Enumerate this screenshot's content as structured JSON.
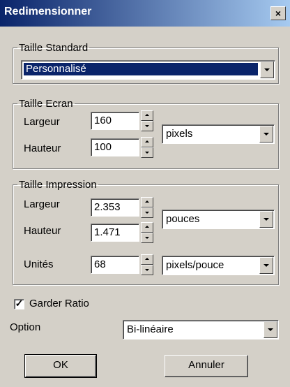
{
  "window": {
    "title": "Redimensionner",
    "close_glyph": "×",
    "close_icon": "close-icon"
  },
  "standard_size": {
    "legend": "Taille Standard",
    "selected": "Personnalisé"
  },
  "screen_size": {
    "legend": "Taille Ecran",
    "width_label": "Largeur",
    "width_value": "160",
    "height_label": "Hauteur",
    "height_value": "100",
    "unit_selected": "pixels"
  },
  "print_size": {
    "legend": "Taille Impression",
    "width_label": "Largeur",
    "width_value": "2.353",
    "height_label": "Hauteur",
    "height_value": "1.471",
    "unit_selected": "pouces",
    "units_label": "Unités",
    "units_value": "68",
    "resolution_selected": "pixels/pouce"
  },
  "keep_ratio": {
    "label": "Garder Ratio",
    "checked": true,
    "check_glyph": "✓"
  },
  "option": {
    "label": "Option",
    "selected": "Bi-linéaire"
  },
  "buttons": {
    "ok": "OK",
    "cancel": "Annuler"
  },
  "colors": {
    "titlebar_start": "#0a246a",
    "titlebar_end": "#a6caf0",
    "dialog_bg": "#d4d0c8",
    "selection": "#0a246a"
  }
}
